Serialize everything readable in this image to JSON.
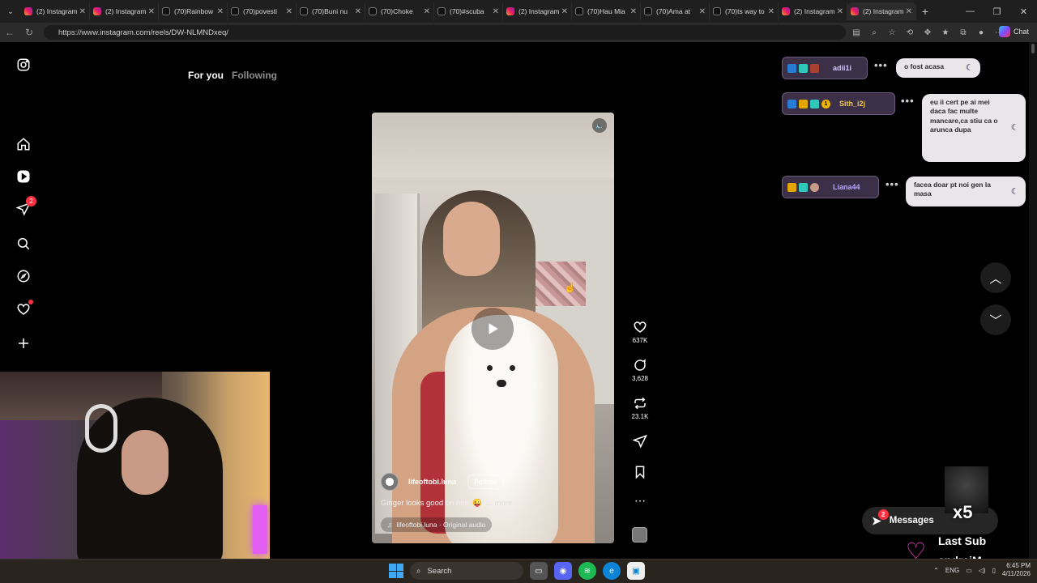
{
  "browser": {
    "tabs": [
      {
        "label": "(2) Instagram",
        "icon": "instagram-icon",
        "active": false
      },
      {
        "label": "(2) Instagram",
        "icon": "instagram-icon",
        "active": false
      },
      {
        "label": "(70)Rainbow",
        "icon": "tiktok-icon",
        "active": false
      },
      {
        "label": "(70)povesti",
        "icon": "tiktok-icon",
        "active": false
      },
      {
        "label": "(70)Buni nu",
        "icon": "tiktok-icon",
        "active": false
      },
      {
        "label": "(70)Choke",
        "icon": "tiktok-icon",
        "active": false
      },
      {
        "label": "(70)#scuba",
        "icon": "tiktok-icon",
        "active": false
      },
      {
        "label": "(2) Instagram",
        "icon": "instagram-icon",
        "active": false
      },
      {
        "label": "(70)Hau Mia",
        "icon": "tiktok-icon",
        "active": false
      },
      {
        "label": "(70)Ama at",
        "icon": "tiktok-icon",
        "active": false
      },
      {
        "label": "(70)ts way to",
        "icon": "tiktok-icon",
        "active": false
      },
      {
        "label": "(2) Instagram",
        "icon": "instagram-icon",
        "active": false
      },
      {
        "label": "(2) Instagram",
        "icon": "instagram-icon",
        "active": true
      }
    ],
    "url": "https://www.instagram.com/reels/DW-NLMNDxeq/",
    "chat_label": "Chat"
  },
  "sidebar": {
    "notifications_badge": "2"
  },
  "feed_tabs": {
    "for_you": "For you",
    "following": "Following"
  },
  "reel": {
    "username": "lifeoftobi.luna",
    "follow_label": "Follow",
    "caption": "Ginger looks good on him",
    "caption_emoji": "😜",
    "more_label": "... more",
    "audio": "lifeoftobi.luna · Original audio",
    "likes": "637K",
    "comments": "3,628",
    "reposts": "23.1K"
  },
  "messages": {
    "label": "Messages",
    "badge": "2"
  },
  "chat_overlay": [
    {
      "user": "adii1i",
      "message": "o fost acasa"
    },
    {
      "user": "Sith_i2j",
      "badge_number": "1",
      "message": "eu ii cert pe ai mei daca fac multe mancare,ca stiu ca o arunca dupa"
    },
    {
      "user": "Liana44",
      "message": "facea doar pt noi gen la masa"
    }
  ],
  "stream": {
    "multiplier": "x5",
    "last_sub_title": "Last Sub",
    "last_sub_name": "andreiM"
  },
  "taskbar": {
    "search_label": "Search",
    "language": "ENG",
    "time": "6:45 PM",
    "date": "4/11/2026"
  },
  "colors": {
    "instagram_badge": "#ff3040",
    "sub_heart": "#ff3bd4",
    "chat_user_bg": "#3c2f48"
  }
}
